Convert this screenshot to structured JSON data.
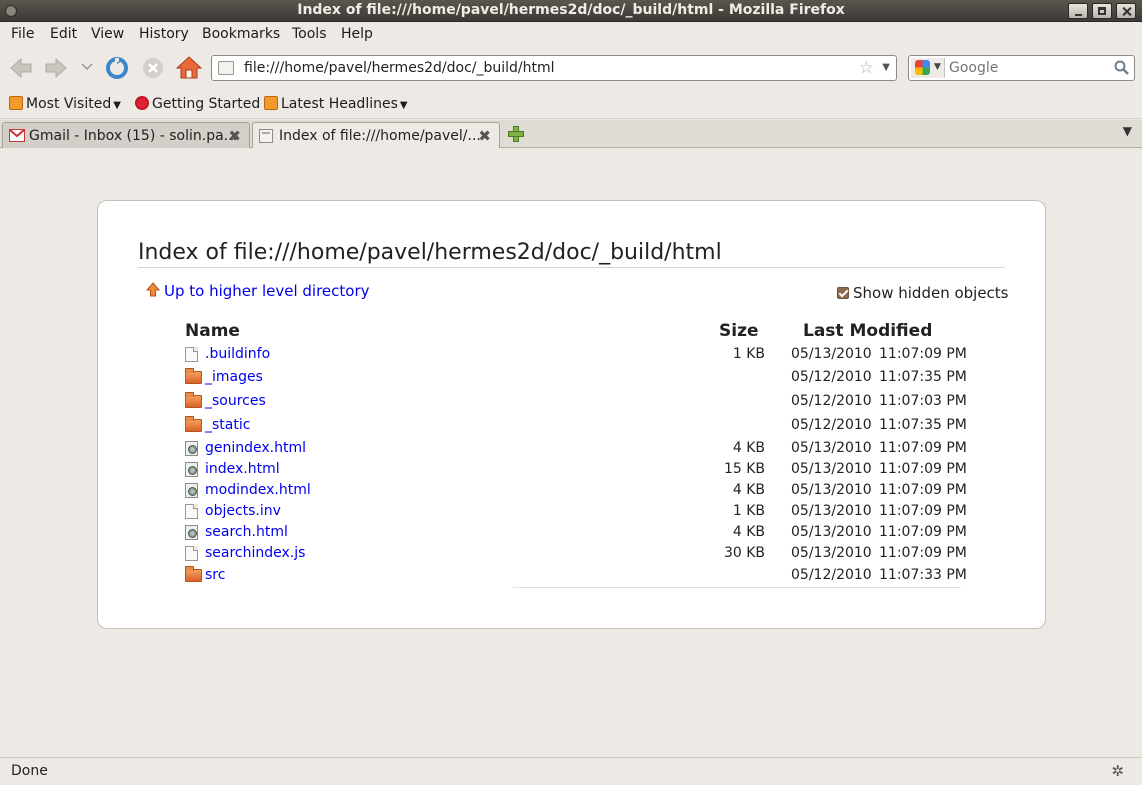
{
  "window": {
    "title": "Index of file:///home/pavel/hermes2d/doc/_build/html - Mozilla Firefox"
  },
  "menu": [
    "File",
    "Edit",
    "View",
    "History",
    "Bookmarks",
    "Tools",
    "Help"
  ],
  "nav": {
    "url": "file:///home/pavel/hermes2d/doc/_build/html",
    "search_placeholder": "Google"
  },
  "bookmarks": [
    {
      "label": "Most Visited",
      "icon": "rss-folder-icon",
      "dropdown": true
    },
    {
      "label": "Getting Started",
      "icon": "firefox-icon",
      "dropdown": false
    },
    {
      "label": "Latest Headlines",
      "icon": "rss-icon",
      "dropdown": true
    }
  ],
  "tabs": [
    {
      "label": "Gmail - Inbox (15) - solin.pa...",
      "icon": "gmail-icon",
      "active": false
    },
    {
      "label": "Index of file:///home/pavel/...",
      "icon": "page-icon",
      "active": true
    }
  ],
  "page": {
    "heading": "Index of file:///home/pavel/hermes2d/doc/_build/html",
    "up_link": "Up to higher level directory",
    "show_hidden_label": "Show hidden objects",
    "show_hidden_checked": true,
    "columns": {
      "name": "Name",
      "size": "Size",
      "modified": "Last Modified"
    },
    "files": [
      {
        "name": ".buildinfo",
        "type": "file",
        "size": "1 KB",
        "date": "05/13/2010",
        "time": "11:07:09 PM"
      },
      {
        "name": "_images",
        "type": "folder",
        "size": "",
        "date": "05/12/2010",
        "time": "11:07:35 PM"
      },
      {
        "name": "_sources",
        "type": "folder",
        "size": "",
        "date": "05/12/2010",
        "time": "11:07:03 PM"
      },
      {
        "name": "_static",
        "type": "folder",
        "size": "",
        "date": "05/12/2010",
        "time": "11:07:35 PM"
      },
      {
        "name": "genindex.html",
        "type": "html",
        "size": "4 KB",
        "date": "05/13/2010",
        "time": "11:07:09 PM"
      },
      {
        "name": "index.html",
        "type": "html",
        "size": "15 KB",
        "date": "05/13/2010",
        "time": "11:07:09 PM"
      },
      {
        "name": "modindex.html",
        "type": "html",
        "size": "4 KB",
        "date": "05/13/2010",
        "time": "11:07:09 PM"
      },
      {
        "name": "objects.inv",
        "type": "file",
        "size": "1 KB",
        "date": "05/13/2010",
        "time": "11:07:09 PM"
      },
      {
        "name": "search.html",
        "type": "html",
        "size": "4 KB",
        "date": "05/13/2010",
        "time": "11:07:09 PM"
      },
      {
        "name": "searchindex.js",
        "type": "file",
        "size": "30 KB",
        "date": "05/13/2010",
        "time": "11:07:09 PM"
      },
      {
        "name": "src",
        "type": "folder",
        "size": "",
        "date": "05/12/2010",
        "time": "11:07:33 PM"
      }
    ]
  },
  "status": {
    "text": "Done"
  }
}
